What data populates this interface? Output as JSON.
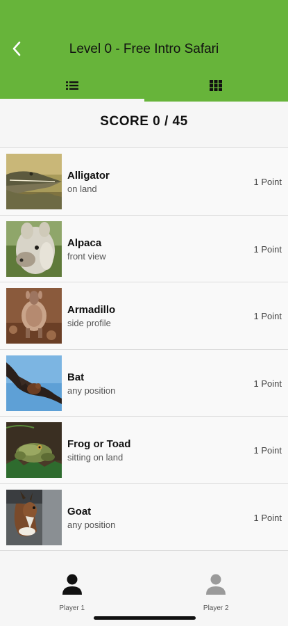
{
  "header": {
    "title": "Level 0 - Free Intro Safari",
    "back_icon": "chevron-left-icon",
    "tabs": [
      {
        "icon": "list-icon",
        "active": true
      },
      {
        "icon": "grid-icon",
        "active": false
      }
    ],
    "accent": "#67b43a"
  },
  "score": {
    "text": "SCORE 0 / 45"
  },
  "animals": [
    {
      "name": "Alligator",
      "subtitle": "on land",
      "points": "1 Point",
      "image": "alligator-photo"
    },
    {
      "name": "Alpaca",
      "subtitle": "front view",
      "points": "1 Point",
      "image": "alpaca-photo"
    },
    {
      "name": "Armadillo",
      "subtitle": "side profile",
      "points": "1 Point",
      "image": "armadillo-photo"
    },
    {
      "name": "Bat",
      "subtitle": "any position",
      "points": "1 Point",
      "image": "bat-photo"
    },
    {
      "name": "Frog or Toad",
      "subtitle": "sitting on land",
      "points": "1 Point",
      "image": "frog-photo"
    },
    {
      "name": "Goat",
      "subtitle": "any position",
      "points": "1 Point",
      "image": "goat-photo"
    }
  ],
  "players": [
    {
      "label": "Player 1",
      "icon": "person-icon",
      "active": true
    },
    {
      "label": "Player 2",
      "icon": "person-icon",
      "active": false
    }
  ]
}
